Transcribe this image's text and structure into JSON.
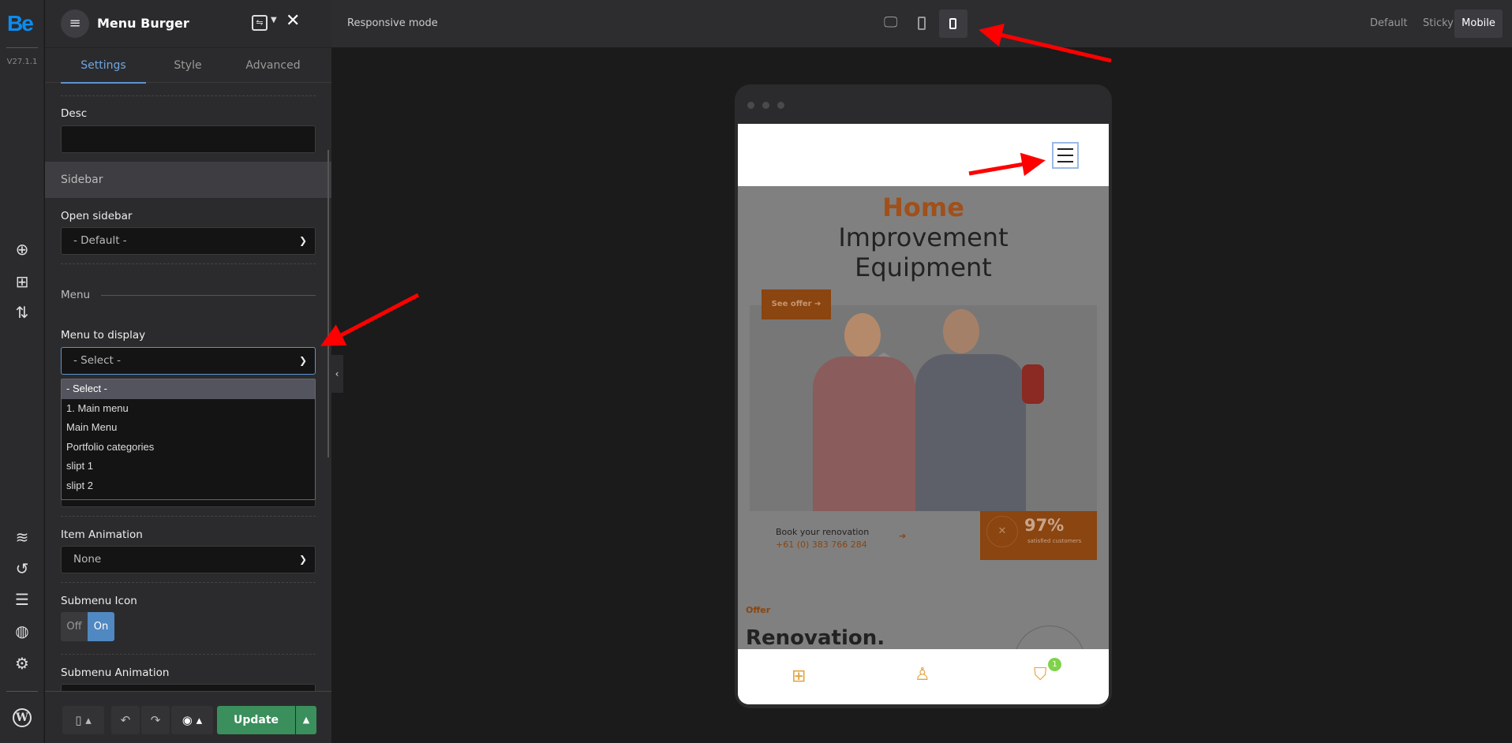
{
  "rail": {
    "logo": "Be",
    "version": "V27.1.1"
  },
  "panel": {
    "title": "Menu Burger",
    "tabs": [
      "Settings",
      "Style",
      "Advanced"
    ],
    "desc_label": "Desc",
    "desc_value": "",
    "section_sidebar": "Sidebar",
    "open_sidebar_label": "Open sidebar",
    "open_sidebar_value": "- Default -",
    "menu_heading": "Menu",
    "menu_to_display_label": "Menu to display",
    "menu_to_display_value": "- Select -",
    "menu_options": [
      "- Select -",
      "1. Main menu",
      "Main Menu",
      "Portfolio categories",
      "slipt 1",
      "slipt 2"
    ],
    "item_animation_label": "Item Animation",
    "item_animation_value": "None",
    "submenu_icon_label": "Submenu Icon",
    "toggle_off": "Off",
    "toggle_on": "On",
    "submenu_icon_state": "On",
    "submenu_animation_label": "Submenu Animation",
    "update_label": "Update"
  },
  "topbar": {
    "responsive_label": "Responsive mode",
    "devices": [
      "desktop",
      "tablet",
      "mobile"
    ],
    "active_device": "mobile",
    "modes": [
      "Default",
      "Sticky",
      "Mobile"
    ],
    "active_mode": "Mobile"
  },
  "preview": {
    "hero_line1": "Home",
    "hero_line2": "Improvement",
    "hero_line3": "Equipment",
    "see_offer": "See offer",
    "book_title": "Book your renovation",
    "book_phone": "+61 (0) 383 766 284",
    "stat_value": "97%",
    "stat_label": "satisfied customers",
    "offer_label": "Offer",
    "offer_title": "Renovation.",
    "cart_count": "1"
  },
  "colors": {
    "accent": "#5b93d3",
    "brand": "#0a8cf0",
    "update": "#3a8f5c",
    "orange": "#a0501a",
    "annotation": "#ff0000"
  }
}
